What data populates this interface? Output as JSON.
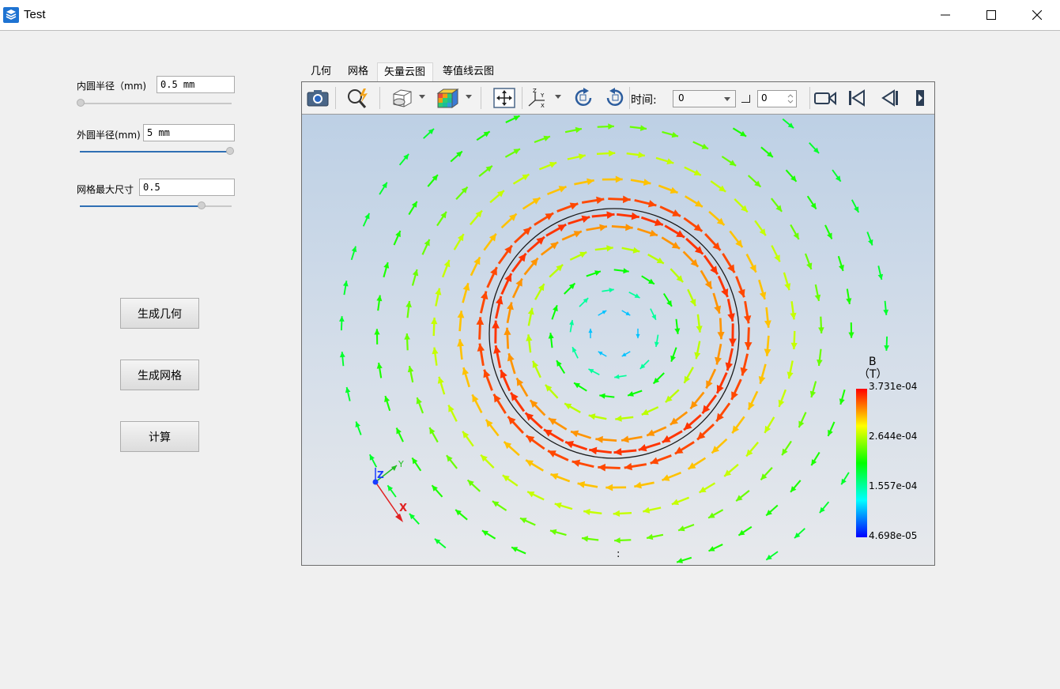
{
  "window": {
    "title": "Test",
    "icons": {
      "app": "app-icon",
      "minimize": "minimize-icon",
      "maximize": "maximize-icon",
      "close": "close-icon"
    }
  },
  "params": {
    "inner_radius": {
      "label": "内圆半径（mm)",
      "value": "0.5 mm",
      "slider": 0.0
    },
    "outer_radius": {
      "label": "外圆半径(mm)",
      "value": "5 mm",
      "slider": 1.0
    },
    "mesh_size": {
      "label": "网格最大尺寸",
      "value": "0.5",
      "slider": 0.8
    }
  },
  "buttons": {
    "gen_geometry": "生成几何",
    "gen_mesh": "生成网格",
    "compute": "计算"
  },
  "tabs": [
    {
      "label": "几何",
      "active": false
    },
    {
      "label": "网格",
      "active": false
    },
    {
      "label": "矢量云图",
      "active": true
    },
    {
      "label": "等值线云图",
      "active": false
    }
  ],
  "toolbar": {
    "tools": [
      "camera-icon",
      "zoom-fit-icon",
      "view-mode-icon",
      "colormap-icon",
      "pan-icon",
      "axes-orientation-icon",
      "rotate-cw-icon",
      "rotate-ccw-icon",
      "record-icon",
      "first-frame-icon",
      "previous-frame-icon",
      "more-icon"
    ],
    "time_label": "时间:",
    "time_value": "0",
    "step_value": "0"
  },
  "colorbar": {
    "title_line1": "B",
    "title_line2": "（T）",
    "ticks": [
      "3.731e-04",
      "2.644e-04",
      "1.557e-04",
      "4.698e-05"
    ],
    "colors": [
      "#ff0000",
      "#ffff00",
      "#00ff00",
      "#00ffff",
      "#0000ff"
    ]
  },
  "axes": {
    "x": "X",
    "y": "Y",
    "z": "Z"
  },
  "scene_marker": ":"
}
